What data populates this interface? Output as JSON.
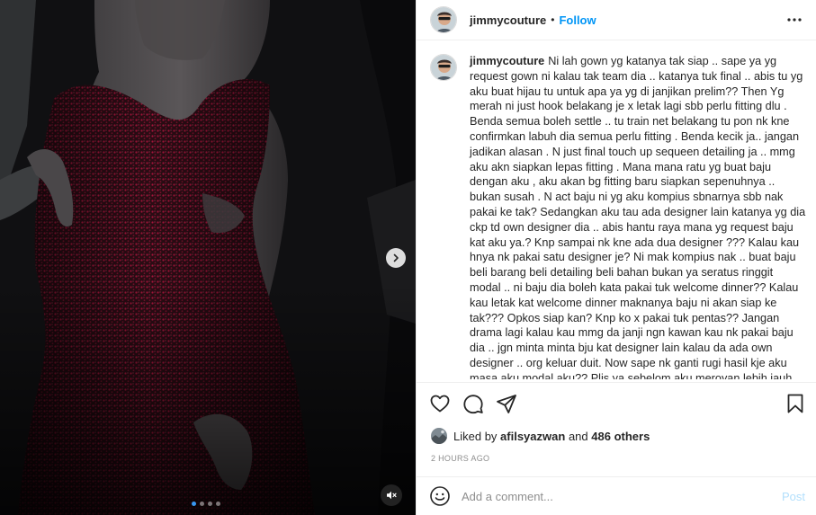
{
  "post": {
    "username": "jimmycouture",
    "separator": "•",
    "follow_label": "Follow",
    "caption_text": "Ni lah gown yg katanya tak siap .. sape ya yg request gown ni kalau tak team dia .. katanya tuk final .. abis tu yg aku buat hijau tu untuk apa ya yg di janjikan prelim?? Then Yg merah ni just hook belakang je x letak lagi sbb perlu fitting dlu . Benda semua boleh settle .. tu train net belakang tu pon nk kne confirmkan labuh dia semua perlu fitting . Benda kecik ja.. jangan jadikan alasan . N just final touch up sequeen detailing ja .. mmg aku akn siapkan lepas fitting . Mana mana ratu yg buat baju dengan aku , aku akan bg fitting baru siapkan sepenuhnya .. bukan susah . N act baju ni yg aku kompius sbnarnya sbb nak pakai ke tak? Sedangkan aku tau ada designer lain katanya yg dia ckp td own designer dia .. abis hantu raya mana yg request baju kat aku ya.? Knp sampai nk kne ada dua designer ??? Kalau kau hnya nk pakai satu designer je? Ni mak kompius nak .. buat baju beli barang beli detailing beli bahan bukan ya seratus ringgit modal .. ni baju dia boleh kata pakai tuk welcome dinner?? Kalau kau letak kat welcome dinner maknanya baju ni akan siap ke tak??? Opkos siap kan? Knp ko x pakai tuk pentas?? Jangan drama lagi kalau kau mmg da janji ngn kawan kau nk pakai baju dia .. jgn minta minta bju kat designer lain kalau da ada own designer .. org keluar duit. Now sape nk ganti rugi hasil kje aku masa aku modal aku?? Plis ya sebelom aku meroyan lebih jauh .. x yh drama airmata .. aku ni patut menangis sbb duit terbang",
    "liked_by_prefix": "Liked by",
    "liked_by_user": "afilsyazwan",
    "liked_by_middle": "and",
    "liked_by_count": "486 others",
    "timestamp": "2 HOURS AGO",
    "comment_placeholder": "Add a comment...",
    "post_label": "Post"
  },
  "carousel": {
    "total": 4,
    "active": 0
  },
  "icons": {
    "more": "more-options-icon",
    "like": "heart-icon",
    "comment": "comment-icon",
    "share": "share-icon",
    "save": "bookmark-icon",
    "next": "chevron-right-icon",
    "mute": "speaker-muted-icon",
    "emoji": "emoji-icon"
  },
  "colors": {
    "accent": "#0095f6",
    "post_disabled": "#b2dffc",
    "muted_text": "#8e8e8e"
  }
}
